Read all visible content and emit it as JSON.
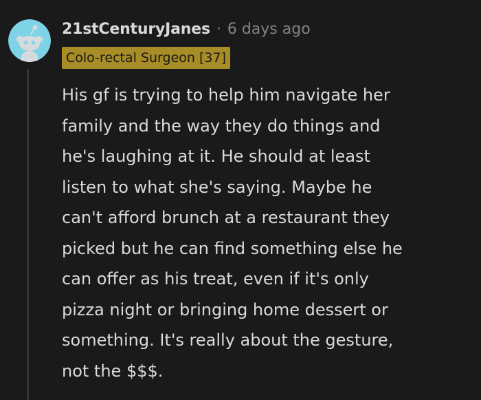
{
  "comment": {
    "author": "21stCenturyJanes",
    "separator": "·",
    "timestamp": "6 days ago",
    "flair": "Colo-rectal Surgeon [37]",
    "avatar_icon": "reddit-snoo-avatar-icon",
    "body_lines": [
      "His gf is trying to help him navigate her",
      "family and the way they do things and",
      "he's laughing at it. He should at least",
      "listen to what she's saying. Maybe he",
      "can't afford brunch at a restaurant they",
      "picked but he can find something else he",
      "can offer as his treat, even if it's only",
      "pizza night or bringing home dessert or",
      "something. It's really about the gesture,",
      "not the $$$."
    ]
  },
  "colors": {
    "background": "#1a1a1b",
    "text": "#d7dadc",
    "meta": "#818384",
    "flair_bg": "#a88c26",
    "avatar_bg": "#7fd3e6",
    "thread_line": "#343536"
  }
}
